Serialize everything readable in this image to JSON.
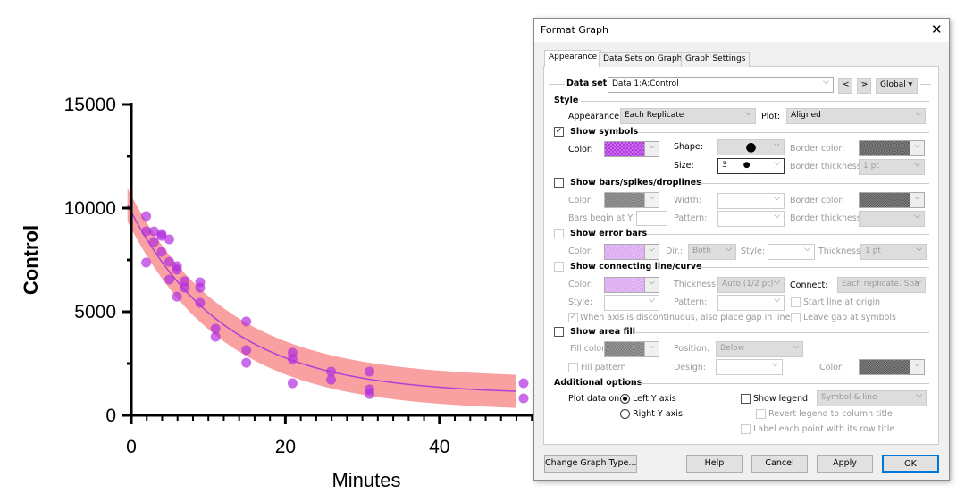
{
  "chart_data": {
    "type": "scatter",
    "xlabel": "Minutes",
    "ylabel": "Control",
    "xlim": [
      0,
      50
    ],
    "ylim": [
      0,
      15000
    ],
    "xticks": [
      "0",
      "20",
      "40"
    ],
    "yticks": [
      "0",
      "5000",
      "10000",
      "15000"
    ],
    "grid": false,
    "points": [
      [
        1,
        9610
      ],
      [
        1,
        7370
      ],
      [
        1,
        8880
      ],
      [
        2,
        8880
      ],
      [
        2,
        8360
      ],
      [
        3,
        8750
      ],
      [
        3,
        8660
      ],
      [
        3,
        7890
      ],
      [
        4,
        8490
      ],
      [
        4,
        7410
      ],
      [
        4,
        6550
      ],
      [
        5,
        7200
      ],
      [
        5,
        7030
      ],
      [
        5,
        5730
      ],
      [
        6,
        6470
      ],
      [
        6,
        6160
      ],
      [
        8,
        6420
      ],
      [
        8,
        6160
      ],
      [
        8,
        5430
      ],
      [
        10,
        4180
      ],
      [
        10,
        3790
      ],
      [
        14,
        4530
      ],
      [
        14,
        3150
      ],
      [
        14,
        2540
      ],
      [
        20,
        3020
      ],
      [
        20,
        2720
      ],
      [
        20,
        1550
      ],
      [
        25,
        2110
      ],
      [
        25,
        1720
      ],
      [
        30,
        2110
      ],
      [
        30,
        1250
      ],
      [
        30,
        1030
      ],
      [
        50,
        1550
      ],
      [
        50,
        820
      ]
    ],
    "fit": {
      "model": "one-phase decay",
      "y0": 9800,
      "plateau": 1000,
      "k": 0.08,
      "band": 800
    },
    "colors": {
      "points": "#b22ee0",
      "curve": "#b040d8",
      "band": "#f9a0a0"
    }
  },
  "dialog": {
    "title": "Format Graph",
    "tabs": [
      "Appearance",
      "Data Sets on Graph",
      "Graph Settings"
    ],
    "data_set_label": "Data set:",
    "data_set_value": "Data 1:A:Control",
    "prev": "<",
    "next": ">",
    "global": "Global",
    "style": {
      "heading": "Style",
      "appearance_label": "Appearance:",
      "appearance_value": "Each Replicate",
      "plot_label": "Plot:",
      "plot_value": "Aligned"
    },
    "symbols": {
      "heading": "Show symbols",
      "checked": true,
      "color_label": "Color:",
      "shape_label": "Shape:",
      "size_label": "Size:",
      "size_value": "3",
      "border_color_label": "Border color:",
      "border_thickness_label": "Border thickness:",
      "border_thickness_value": "1 pt"
    },
    "bars": {
      "heading": "Show bars/spikes/droplines",
      "checked": false,
      "color_label": "Color:",
      "width_label": "Width:",
      "border_color_label": "Border color:",
      "begin_label": "Bars begin at Y =",
      "pattern_label": "Pattern:",
      "border_thickness_label": "Border thickness:"
    },
    "errorbars": {
      "heading": "Show error bars",
      "checked": false,
      "color_label": "Color:",
      "dir_label": "Dir.:",
      "dir_value": "Both",
      "style_label": "Style:",
      "thickness_label": "Thickness:",
      "thickness_value": "1 pt"
    },
    "line": {
      "heading": "Show connecting line/curve",
      "checked": false,
      "color_label": "Color:",
      "thickness_label": "Thickness:",
      "thickness_value": "Auto (1/2 pt)",
      "connect_label": "Connect:",
      "connect_value": "Each replicate. Spa",
      "style_label": "Style:",
      "pattern_label": "Pattern:",
      "start_origin": "Start line at origin",
      "gap_discontinuous": "When axis is discontinuous, also place gap in line",
      "leave_gap": "Leave gap at symbols"
    },
    "area": {
      "heading": "Show area fill",
      "checked": false,
      "fill_color_label": "Fill color:",
      "position_label": "Position:",
      "position_value": "Below",
      "fill_pattern": "Fill pattern",
      "design_label": "Design:",
      "color_label": "Color:"
    },
    "additional": {
      "heading": "Additional options",
      "plot_on_label": "Plot data on:",
      "left": "Left Y axis",
      "right": "Right  Y axis",
      "show_legend": "Show legend",
      "legend_value": "Symbol & line",
      "revert": "Revert legend to column title",
      "label_points": "Label each point with its row title"
    },
    "buttons": {
      "change": "Change Graph Type...",
      "help": "Help",
      "cancel": "Cancel",
      "apply": "Apply",
      "ok": "OK"
    }
  }
}
